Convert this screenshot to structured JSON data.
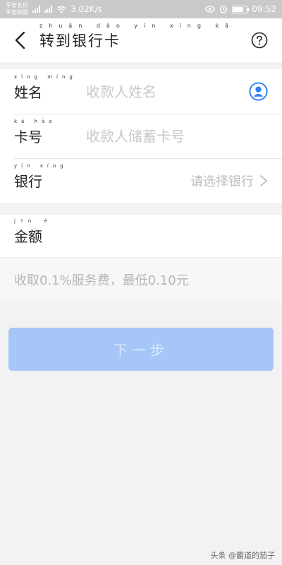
{
  "status_bar": {
    "carrier_1": "平安名侦",
    "carrier_2": "平安收银",
    "speed": "3.02K/s",
    "time": "09:52"
  },
  "header": {
    "title": "转到银行卡",
    "title_pinyin": "zhuǎn dào yín xíng kǎ",
    "help_icon": "help-circle-icon",
    "back_icon": "chevron-left-icon"
  },
  "form": {
    "name": {
      "label": "姓名",
      "pinyin": "xìng míng",
      "placeholder": "收款人姓名",
      "icon": "contact-icon"
    },
    "card_no": {
      "label": "卡号",
      "pinyin": "kǎ hào",
      "placeholder": "收款人储蓄卡号"
    },
    "bank": {
      "label": "银行",
      "pinyin": "yín xíng",
      "select_text": "请选择银行"
    }
  },
  "amount": {
    "label": "金额",
    "pinyin": "jīn é",
    "fee_note": "收取0.1%服务费，最低0.10元"
  },
  "next_button": {
    "label": "下一步"
  },
  "watermark": "头条 @霸道的茄子",
  "colors": {
    "accent": "#2f7ff0",
    "button_disabled": "#a7c6f8",
    "background": "#f2f2f2"
  }
}
